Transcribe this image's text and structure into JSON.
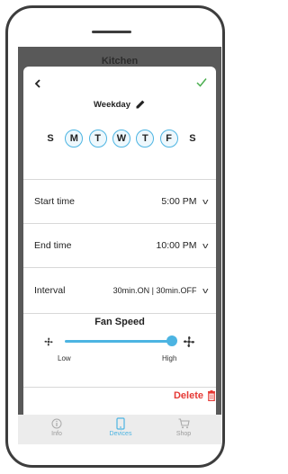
{
  "background": {
    "title": "Kitchen"
  },
  "header": {
    "title": "Weekday"
  },
  "days": [
    {
      "label": "S",
      "selected": false
    },
    {
      "label": "M",
      "selected": true
    },
    {
      "label": "T",
      "selected": true
    },
    {
      "label": "W",
      "selected": true
    },
    {
      "label": "T",
      "selected": true
    },
    {
      "label": "F",
      "selected": true
    },
    {
      "label": "S",
      "selected": false
    }
  ],
  "settings": {
    "start_time": {
      "label": "Start time",
      "value": "5:00 PM"
    },
    "end_time": {
      "label": "End time",
      "value": "10:00 PM"
    },
    "interval": {
      "label": "Interval",
      "value": "30min.ON | 30min.OFF"
    }
  },
  "fan_speed": {
    "title": "Fan Speed",
    "min_label": "Low",
    "max_label": "High",
    "level": 1.0
  },
  "delete_label": "Delete",
  "tabs": [
    {
      "label": "Info",
      "active": false
    },
    {
      "label": "Devices",
      "active": true
    },
    {
      "label": "Shop",
      "active": false
    }
  ],
  "colors": {
    "accent": "#4cb4e2",
    "confirm": "#4caf50",
    "delete": "#e53935"
  }
}
